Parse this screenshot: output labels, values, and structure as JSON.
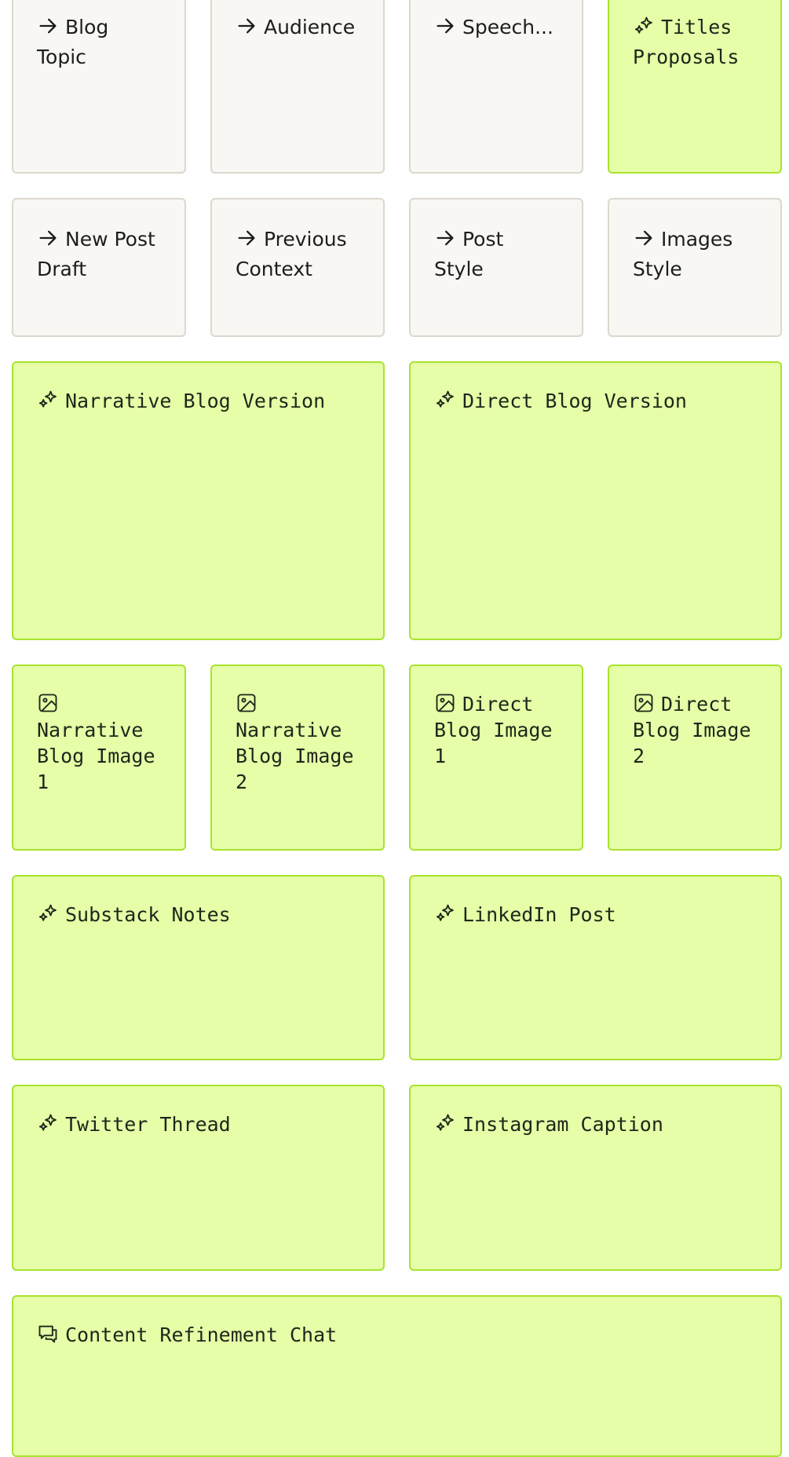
{
  "cards": {
    "blog_topic": {
      "label": "Blog Topic",
      "icon": "arrow-right-icon"
    },
    "audience": {
      "label": "Audience",
      "icon": "arrow-right-icon"
    },
    "speech": {
      "label": "Speech...",
      "icon": "arrow-right-icon"
    },
    "titles_proposals": {
      "label": "Titles Proposals",
      "icon": "sparkles-icon"
    },
    "new_post_draft": {
      "label": "New Post Draft",
      "icon": "arrow-right-icon"
    },
    "previous_context": {
      "label": "Previous Context",
      "icon": "arrow-right-icon"
    },
    "post_style": {
      "label": "Post Style",
      "icon": "arrow-right-icon"
    },
    "images_style": {
      "label": "Images Style",
      "icon": "arrow-right-icon"
    },
    "narrative_blog_version": {
      "label": "Narrative Blog Version",
      "icon": "sparkles-icon"
    },
    "direct_blog_version": {
      "label": "Direct Blog Version",
      "icon": "sparkles-icon"
    },
    "narrative_blog_image_1": {
      "label": "Narrative Blog Image 1",
      "icon": "image-icon"
    },
    "narrative_blog_image_2": {
      "label": "Narrative Blog Image 2",
      "icon": "image-icon"
    },
    "direct_blog_image_1": {
      "label": "Direct Blog Image 1",
      "icon": "image-icon"
    },
    "direct_blog_image_2": {
      "label": "Direct Blog Image 2",
      "icon": "image-icon"
    },
    "substack_notes": {
      "label": "Substack Notes",
      "icon": "sparkles-icon"
    },
    "linkedin_post": {
      "label": "LinkedIn Post",
      "icon": "sparkles-icon"
    },
    "twitter_thread": {
      "label": "Twitter Thread",
      "icon": "sparkles-icon"
    },
    "instagram_caption": {
      "label": "Instagram Caption",
      "icon": "sparkles-icon"
    },
    "content_refinement_chat": {
      "label": "Content Refinement Chat",
      "icon": "chat-icon"
    }
  },
  "colors": {
    "input_card_bg": "#f8f7f3",
    "input_card_border": "#dcd8cd",
    "output_card_bg": "#e5fea7",
    "output_card_border": "#a9e32e"
  }
}
